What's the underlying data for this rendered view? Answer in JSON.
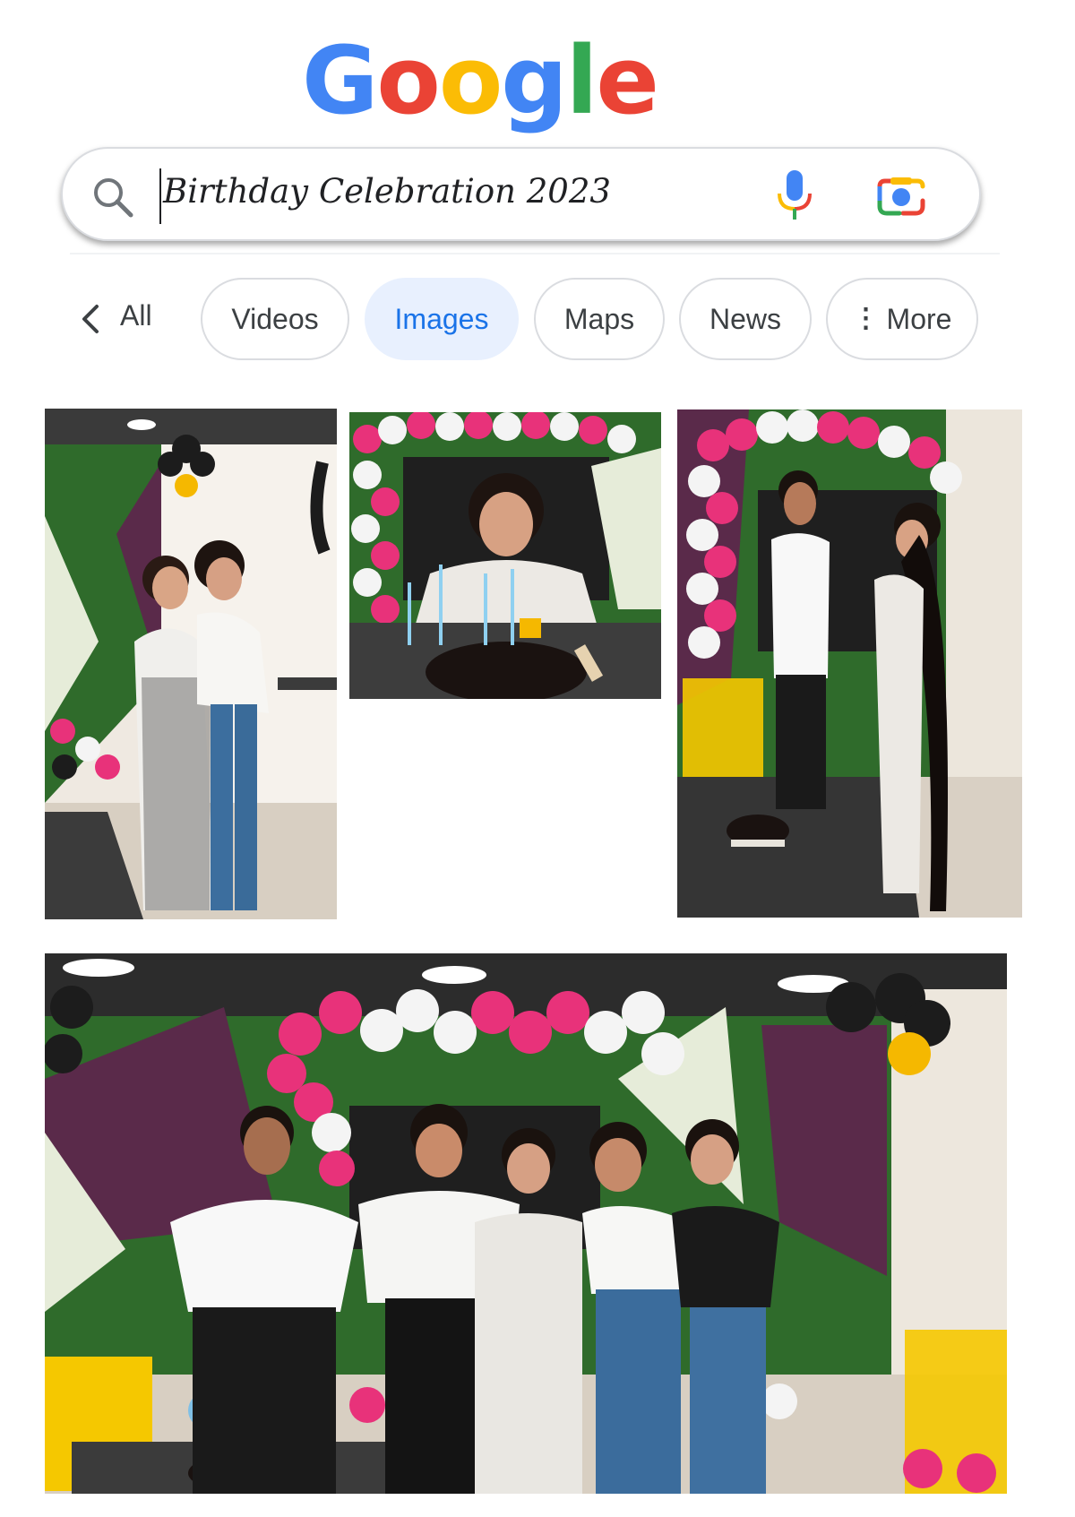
{
  "logo": {
    "letters": [
      "G",
      "o",
      "o",
      "g",
      "l",
      "e"
    ],
    "colors": [
      "#4285F4",
      "#EA4335",
      "#FBBC05",
      "#4285F4",
      "#34A853",
      "#EA4335"
    ]
  },
  "search": {
    "query": "Birthday Celebration 2023"
  },
  "tabs": {
    "all_label": "All",
    "items": [
      {
        "label": "Videos",
        "active": false
      },
      {
        "label": "Images",
        "active": true
      },
      {
        "label": "Maps",
        "active": false
      },
      {
        "label": "News",
        "active": false
      },
      {
        "label": "More",
        "active": false,
        "icon": "more-vert-icon"
      }
    ]
  },
  "results": {
    "images": [
      {
        "name": "two-women-hugging-photo"
      },
      {
        "name": "woman-with-cake-photo"
      },
      {
        "name": "man-and-woman-cake-photo"
      },
      {
        "name": "group-photo"
      }
    ]
  },
  "colors": {
    "accent": "#1a73e8",
    "chip_active_bg": "#e8f0fe",
    "balloon_pink": "#e8327a",
    "balloon_white": "#f4f4f4",
    "balloon_black": "#1c1c1c",
    "balloon_yellow": "#f5b800",
    "wall_green": "#2e6b2a"
  }
}
